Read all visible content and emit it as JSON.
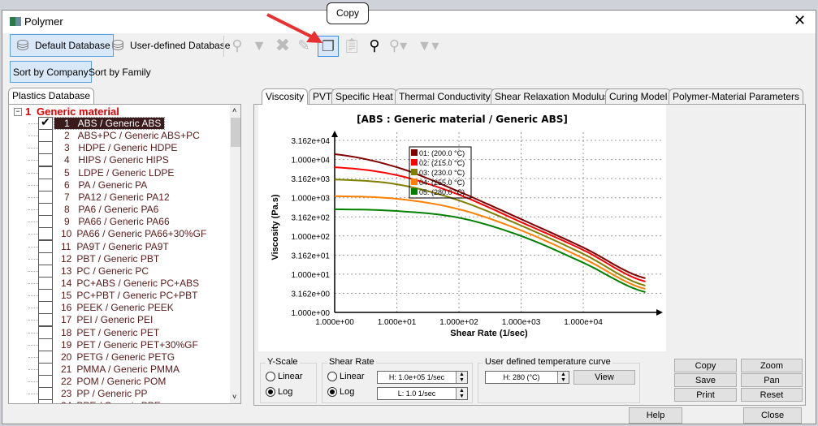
{
  "window": {
    "title": "Polymer",
    "close_icon": "close-icon"
  },
  "toolbar": {
    "default_db": "Default Database",
    "user_db": "User-defined Database",
    "tooltip": "Copy",
    "icons": [
      "add-material-icon",
      "filter-add-icon",
      "delete-icon",
      "edit-icon",
      "copy-icon",
      "paste-icon",
      "search-icon",
      "compare-icon",
      "filter-icon"
    ]
  },
  "sort": {
    "company": "Sort by Company",
    "family": "Sort by Family"
  },
  "left": {
    "tab": "Plastics Database",
    "group_num": "1",
    "group": "Generic material",
    "items": [
      {
        "n": "1",
        "t": "ABS / Generic ABS",
        "checked": true
      },
      {
        "n": "2",
        "t": "ABS+PC / Generic ABS+PC"
      },
      {
        "n": "3",
        "t": "HDPE / Generic HDPE"
      },
      {
        "n": "4",
        "t": "HIPS / Generic HIPS"
      },
      {
        "n": "5",
        "t": "LDPE / Generic LDPE"
      },
      {
        "n": "6",
        "t": "PA / Generic PA"
      },
      {
        "n": "7",
        "t": "PA12 / Generic PA12"
      },
      {
        "n": "8",
        "t": "PA6 / Generic PA6"
      },
      {
        "n": "9",
        "t": "PA66 / Generic PA66"
      },
      {
        "n": "10",
        "t": "PA66 / Generic PA66+30%GF"
      },
      {
        "n": "11",
        "t": "PA9T / Generic PA9T"
      },
      {
        "n": "12",
        "t": "PBT / Generic PBT"
      },
      {
        "n": "13",
        "t": "PC / Generic PC"
      },
      {
        "n": "14",
        "t": "PC+ABS / Generic PC+ABS"
      },
      {
        "n": "15",
        "t": "PC+PBT / Generic PC+PBT"
      },
      {
        "n": "16",
        "t": "PEEK / Generic PEEK"
      },
      {
        "n": "17",
        "t": "PEI / Generic PEI"
      },
      {
        "n": "18",
        "t": "PET / Generic PET"
      },
      {
        "n": "19",
        "t": "PET / Generic PET+30%GF"
      },
      {
        "n": "20",
        "t": "PETG / Generic PETG"
      },
      {
        "n": "21",
        "t": "PMMA / Generic PMMA"
      },
      {
        "n": "22",
        "t": "POM / Generic POM"
      },
      {
        "n": "23",
        "t": "PP / Generic PP"
      },
      {
        "n": "24",
        "t": "PPE / Generic PPE"
      }
    ]
  },
  "tabs": [
    "Viscosity",
    "PVT",
    "Specific Heat",
    "Thermal Conductivity",
    "Shear Relaxation Modulus",
    "Curing Model",
    "Polymer-Material Parameters"
  ],
  "chart_data": {
    "type": "line",
    "title": "[ABS : Generic material / Generic ABS]",
    "xlabel": "Shear Rate (1/sec)",
    "ylabel": "Viscosity (Pa.s)",
    "xscale": "log",
    "yscale": "log",
    "xlim": [
      1,
      100000
    ],
    "ylim": [
      1,
      31620
    ],
    "grid": true,
    "legend": "top-right",
    "xticks": [
      "1.000e+00",
      "1.000e+01",
      "1.000e+02",
      "1.000e+03",
      "1.000e+04"
    ],
    "yticks": [
      "1.000e+00",
      "3.162e+00",
      "1.000e+01",
      "3.162e+01",
      "1.000e+02",
      "3.162e+02",
      "1.000e+03",
      "3.162e+03",
      "1.000e+04",
      "3.162e+04"
    ],
    "x": [
      1,
      10,
      100,
      1000,
      10000,
      100000
    ],
    "series": [
      {
        "name": "01: (200.0 °C)",
        "color": "#800000",
        "values": [
          13800,
          6300,
          1450,
          275,
          50,
          7.8
        ]
      },
      {
        "name": "02: (215.0 °C)",
        "color": "#ff0000",
        "values": [
          6300,
          3900,
          1200,
          230,
          43,
          6.4
        ]
      },
      {
        "name": "03: (230.0 °C)",
        "color": "#808000",
        "values": [
          3000,
          2250,
          850,
          187,
          34,
          5.0
        ]
      },
      {
        "name": "04: (255.0 °C)",
        "color": "#ff8000",
        "values": [
          1100,
          940,
          500,
          140,
          26,
          4.1
        ]
      },
      {
        "name": "05: (280.0 °C)",
        "color": "#008000",
        "values": [
          500,
          450,
          300,
          100,
          20,
          3.4
        ]
      }
    ]
  },
  "controls": {
    "yscale": "Y-Scale",
    "linear": "Linear",
    "log": "Log",
    "shear": "Shear Rate",
    "h_val": "H: 1.0e+05 1/sec",
    "l_val": "L: 1.0 1/sec",
    "user_curve": "User defined temperature curve",
    "temp_val": "H: 280 (°C)",
    "view": "View",
    "copy": "Copy",
    "zoom": "Zoom",
    "save": "Save",
    "pan": "Pan",
    "print": "Print",
    "reset": "Reset",
    "help": "Help",
    "close": "Close"
  }
}
